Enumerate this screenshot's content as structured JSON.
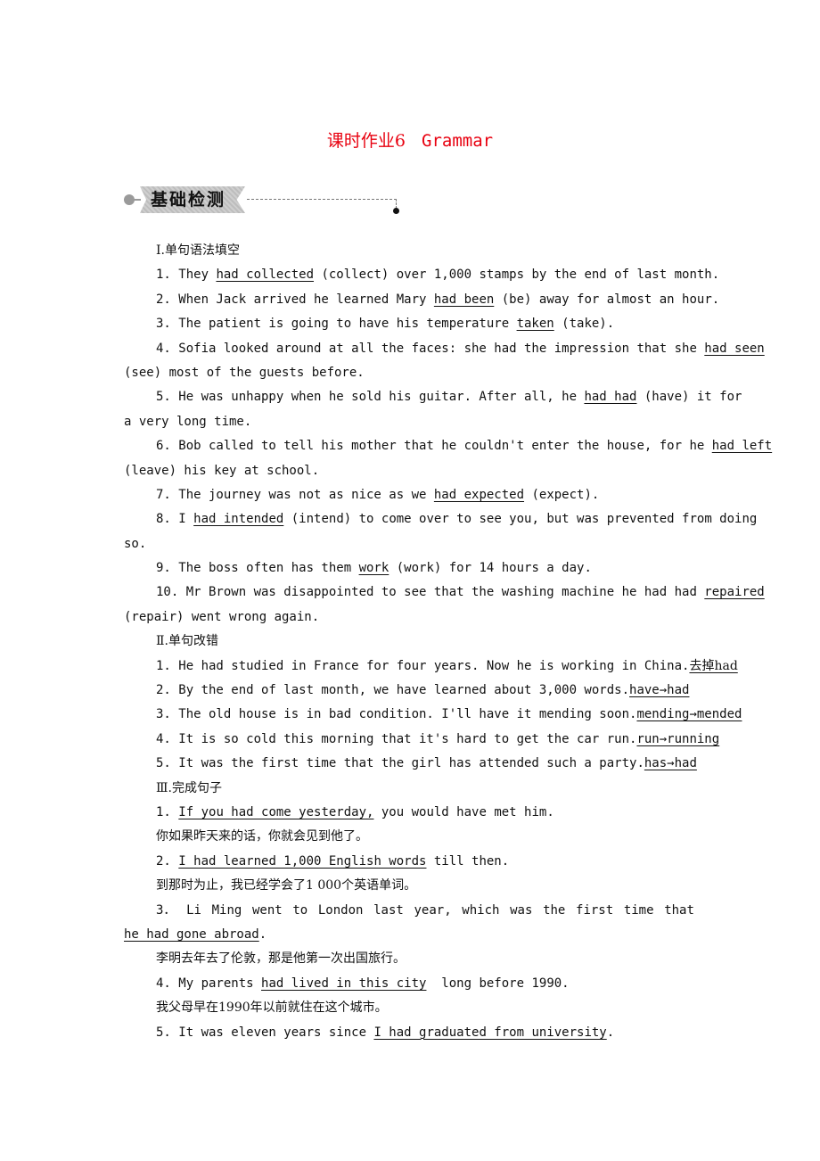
{
  "title": {
    "zh": "课时作业6",
    "en": "Grammar",
    "color": "#e8000f"
  },
  "section_banner": "基础检测",
  "part1": {
    "heading": "Ⅰ.单句语法填空",
    "items": [
      {
        "pre": "1. They ",
        "ans": "had collected",
        "post": " (collect) over 1,000 stamps by the end of last month."
      },
      {
        "pre": "2. When Jack arrived he learned Mary ",
        "ans": "had been",
        "post": " (be) away for almost an hour."
      },
      {
        "pre": "3. The patient is going to have his temperature ",
        "ans": "taken",
        "post": " (take)."
      },
      {
        "pre": "4. Sofia looked around at all the faces: she had the impression that she ",
        "ans": "had seen",
        "post": "",
        "cont": "(see) most of the guests before."
      },
      {
        "pre": "5. He was unhappy when he sold his guitar. After all, he ",
        "ans": "had had",
        "post": " (have) it for",
        "cont": "a very long time."
      },
      {
        "pre": "6. Bob called to tell his mother that he couldn't enter the house, for he ",
        "ans": "had left",
        "post": "",
        "cont": "(leave) his key at school."
      },
      {
        "pre": "7. The journey was not as nice as we ",
        "ans": "had expected",
        "post": " (expect)."
      },
      {
        "pre": "8. I ",
        "ans": "had intended",
        "post": " (intend) to come over to see you, but was prevented from doing",
        "cont": "so."
      },
      {
        "pre": "9. The boss often has them ",
        "ans": "work",
        "post": " (work) for 14 hours a day."
      },
      {
        "pre": "10. Mr Brown was disappointed to see that the washing machine he had had ",
        "ans": "repaired",
        "post": "",
        "cont": "(repair) went wrong again."
      }
    ]
  },
  "part2": {
    "heading": "Ⅱ.单句改错",
    "items": [
      {
        "pre": "1. He had studied in France for four years. Now he is working in China.",
        "ans": "去掉had"
      },
      {
        "pre": "2. By the end of last month, we have learned about 3,000 words.",
        "ans": "have→had"
      },
      {
        "pre": "3. The old house is in bad condition. I'll have it mending soon.",
        "ans": "mending→mended"
      },
      {
        "pre": "4. It is so cold this morning that it's hard to get the car run.",
        "ans": "run→running"
      },
      {
        "pre": "5. It was the first time that the girl has attended such a party.",
        "ans": "has→had"
      }
    ]
  },
  "part3": {
    "heading": "Ⅲ.完成句子",
    "items": [
      {
        "pre": "1. ",
        "ans": "If you had come yesterday,",
        "post": " you would have met him.",
        "zh": "你如果昨天来的话，你就会见到他了。"
      },
      {
        "pre": "2. ",
        "ans": "I had learned 1,000 English words",
        "post": " till then.",
        "zh": "到那时为止，我已经学会了1 000个英语单词。"
      },
      {
        "words": [
          "3．",
          "Li",
          "Ming",
          "went",
          "to",
          "London",
          "last",
          "year,",
          "which",
          "was",
          "the",
          "first",
          "time",
          "that"
        ],
        "ans": "he had gone abroad",
        "post": ".",
        "zh": "李明去年去了伦敦，那是他第一次出国旅行。"
      },
      {
        "pre": "4. My parents ",
        "ans": "had lived in this city",
        "post": "  long before 1990.",
        "zh": "我父母早在1990年以前就住在这个城市。"
      },
      {
        "pre": "5. It was eleven years since ",
        "ans": "I had graduated from university",
        "post": "."
      }
    ]
  }
}
